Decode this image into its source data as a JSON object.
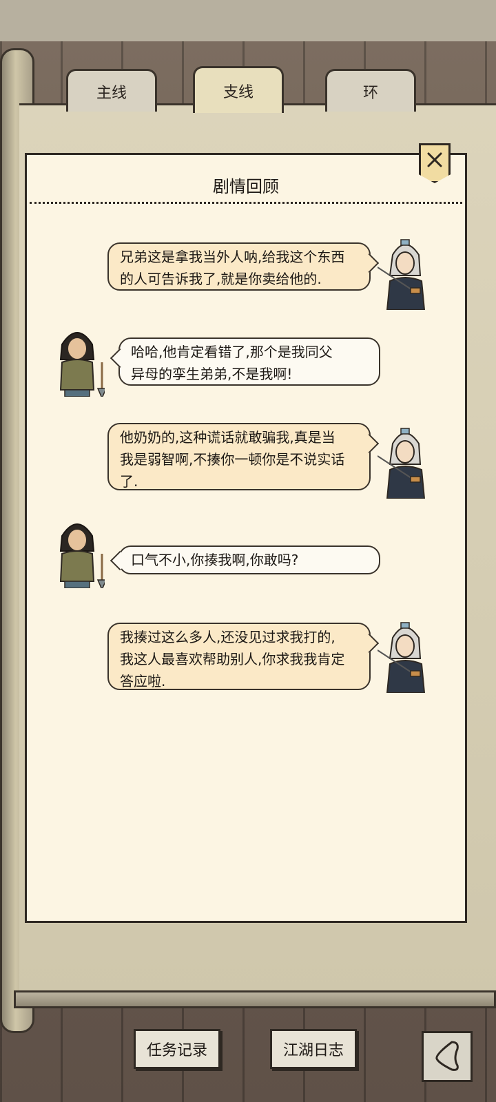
{
  "tabs": [
    {
      "label": "主线",
      "active": false
    },
    {
      "label": "支线",
      "active": true
    },
    {
      "label": "环",
      "active": false
    }
  ],
  "panel": {
    "title": "剧情回顾",
    "close_icon": "close-icon"
  },
  "dialogue": [
    {
      "speaker": "swordsman",
      "side": "right",
      "text_lines": [
        "兄弟这是拿我当外人呐,给我这个东西",
        "的人可告诉我了,就是你卖给他的."
      ]
    },
    {
      "speaker": "farmer",
      "side": "left",
      "text_lines": [
        "哈哈,他肯定看错了,那个是我同父",
        "异母的孪生弟弟,不是我啊!"
      ]
    },
    {
      "speaker": "swordsman",
      "side": "right",
      "text_lines": [
        "他奶奶的,这种谎话就敢骗我,真是当",
        "我是弱智啊,不揍你一顿你是不说实话",
        "了."
      ]
    },
    {
      "speaker": "farmer",
      "side": "left",
      "text_lines": [
        "口气不小,你揍我啊,你敢吗?"
      ]
    },
    {
      "speaker": "swordsman",
      "side": "right",
      "text_lines": [
        "我揍过这么多人,还没见过求我打的,",
        "我这人最喜欢帮助别人,你求我我肯定",
        "答应啦."
      ]
    }
  ],
  "bottom_buttons": {
    "task_log": "任务记录",
    "jianghu_diary": "江湖日志",
    "back_icon": "back-arrow-icon"
  },
  "colors": {
    "panel_bg": "#fcf5e3",
    "bubble_right": "#fbe9c7",
    "bubble_left": "#fdfaf2",
    "outline": "#2e2822"
  }
}
